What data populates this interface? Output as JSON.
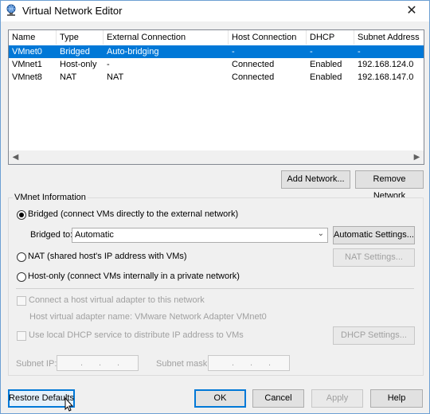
{
  "window": {
    "title": "Virtual Network Editor",
    "close_glyph": "✕"
  },
  "table": {
    "headers": [
      "Name",
      "Type",
      "External Connection",
      "Host Connection",
      "DHCP",
      "Subnet Address"
    ],
    "rows": [
      [
        "VMnet0",
        "Bridged",
        "Auto-bridging",
        "-",
        "-",
        "-"
      ],
      [
        "VMnet1",
        "Host-only",
        "-",
        "Connected",
        "Enabled",
        "192.168.124.0"
      ],
      [
        "VMnet8",
        "NAT",
        "NAT",
        "Connected",
        "Enabled",
        "192.168.147.0"
      ]
    ],
    "selected_row": 0
  },
  "list_buttons": {
    "add": "Add Network...",
    "remove": "Remove Network"
  },
  "vmnet_info": {
    "group_label": "VMnet Information",
    "bridged_label": "Bridged (connect VMs directly to the external network)",
    "bridged_to_label": "Bridged to:",
    "bridged_to_value": "Automatic",
    "auto_settings": "Automatic Settings...",
    "nat_label": "NAT (shared host's IP address with VMs)",
    "nat_settings": "NAT Settings...",
    "hostonly_label": "Host-only (connect VMs internally in a private network)",
    "connect_adapter_label": "Connect a host virtual adapter to this network",
    "adapter_name_label": "Host virtual adapter name: VMware Network Adapter VMnet0",
    "dhcp_label": "Use local DHCP service to distribute IP address to VMs",
    "dhcp_settings": "DHCP Settings...",
    "subnet_ip_label": "Subnet IP:",
    "subnet_mask_label": "Subnet mask:",
    "selected_mode": "bridged"
  },
  "footer": {
    "restore": "Restore Defaults",
    "ok": "OK",
    "cancel": "Cancel",
    "apply": "Apply",
    "help": "Help"
  },
  "colors": {
    "selection": "#0078d7",
    "window_border": "#6d9fd3"
  }
}
